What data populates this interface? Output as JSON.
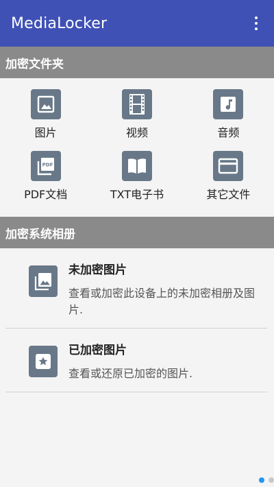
{
  "app": {
    "title": "MediaLocker",
    "colors": {
      "appbar": "#3f51b5",
      "section_header": "#8a8a8a",
      "icon_tile": "#687888",
      "pager_active": "#2196f3"
    }
  },
  "encrypted_folders": {
    "header": "加密文件夹",
    "items": [
      {
        "label": "图片",
        "icon": "image-icon"
      },
      {
        "label": "视频",
        "icon": "film-icon"
      },
      {
        "label": "音频",
        "icon": "music-note-icon"
      },
      {
        "label": "PDF文档",
        "icon": "pdf-icon"
      },
      {
        "label": "TXT电子书",
        "icon": "book-icon"
      },
      {
        "label": "其它文件",
        "icon": "card-icon"
      }
    ]
  },
  "system_album": {
    "header": "加密系统相册",
    "items": [
      {
        "title": "未加密图片",
        "desc": "查看或加密此设备上的未加密相册及图片.",
        "icon": "photo-library-icon"
      },
      {
        "title": "已加密图片",
        "desc": "查看或还原已加密的图片.",
        "icon": "star-icon"
      }
    ]
  },
  "pager": {
    "active_index": 0,
    "count": 2
  }
}
